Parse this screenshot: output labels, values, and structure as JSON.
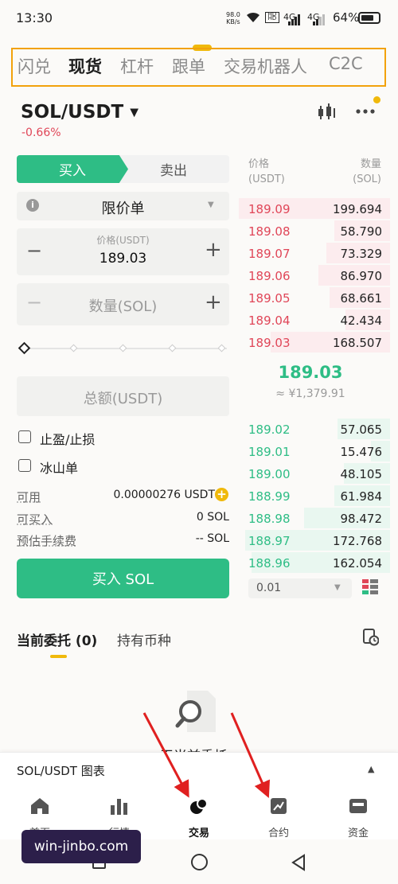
{
  "status": {
    "time": "13:30",
    "net_speed_top": "98.0",
    "net_speed_bottom": "KB/s",
    "signal1": "4G",
    "signal2": "4G",
    "battery": "64%"
  },
  "top_tabs": [
    "闪兑",
    "现货",
    "杠杆",
    "跟单",
    "交易机器人",
    "C2C"
  ],
  "pair": {
    "symbol": "SOL/USDT",
    "change": "-0.66%"
  },
  "order_form": {
    "buy_label": "买入",
    "sell_label": "卖出",
    "order_type": "限价单",
    "price_label": "价格(USDT)",
    "price_value": "189.03",
    "amount_placeholder": "数量(SOL)",
    "total_placeholder": "总额(USDT)",
    "tp_sl_label": "止盈/止损",
    "iceberg_label": "冰山单",
    "available_label": "可用",
    "available_value": "0.00000276 USDT",
    "can_buy_label": "可买入",
    "can_buy_value": "0 SOL",
    "fee_label": "预估手续费",
    "fee_value": "-- SOL",
    "submit_label": "买入 SOL"
  },
  "orderbook": {
    "price_header": "价格",
    "price_unit": "(USDT)",
    "qty_header": "数量",
    "qty_unit": "(SOL)",
    "asks": [
      {
        "price": "189.09",
        "qty": "199.694"
      },
      {
        "price": "189.08",
        "qty": "58.790"
      },
      {
        "price": "189.07",
        "qty": "73.329"
      },
      {
        "price": "189.06",
        "qty": "86.970"
      },
      {
        "price": "189.05",
        "qty": "68.661"
      },
      {
        "price": "189.04",
        "qty": "42.434"
      },
      {
        "price": "189.03",
        "qty": "168.507"
      }
    ],
    "last_price": "189.03",
    "last_price_cny": "≈ ¥1,379.91",
    "bids": [
      {
        "price": "189.02",
        "qty": "57.065"
      },
      {
        "price": "189.01",
        "qty": "15.476"
      },
      {
        "price": "189.00",
        "qty": "48.105"
      },
      {
        "price": "188.99",
        "qty": "61.984"
      },
      {
        "price": "188.98",
        "qty": "98.472"
      },
      {
        "price": "188.97",
        "qty": "172.768"
      },
      {
        "price": "188.96",
        "qty": "162.054"
      }
    ],
    "precision": "0.01"
  },
  "orders": {
    "tab_current": "当前委托 (0)",
    "tab_holdings": "持有币种",
    "empty_text": "无当前委托"
  },
  "chart_bar": {
    "label": "SOL/USDT 图表"
  },
  "bottom_nav": [
    {
      "label": "首页",
      "icon": "home-icon"
    },
    {
      "label": "行情",
      "icon": "market-icon"
    },
    {
      "label": "交易",
      "icon": "trade-icon"
    },
    {
      "label": "合约",
      "icon": "futures-icon"
    },
    {
      "label": "资金",
      "icon": "wallet-icon"
    }
  ],
  "watermark": "win-jinbo.com",
  "colors": {
    "buy_green": "#2ebd85",
    "sell_red": "#e04658",
    "accent": "#f0b90b",
    "highlight_border": "#f2a20c",
    "arrow_red": "#e02020"
  }
}
